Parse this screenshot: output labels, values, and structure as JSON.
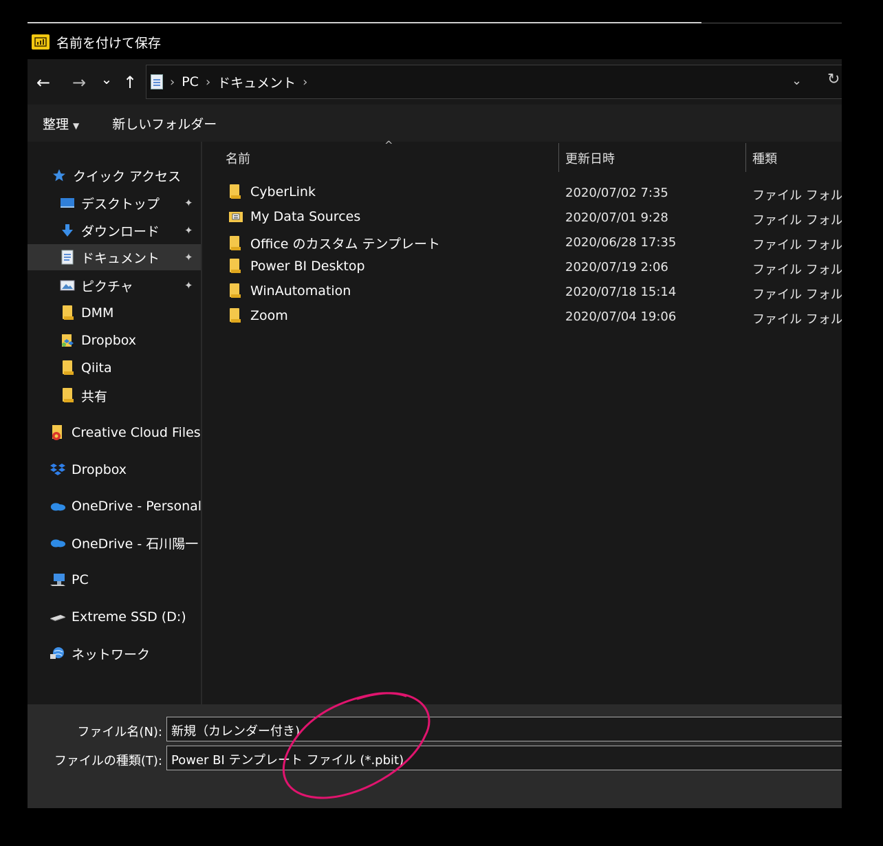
{
  "window": {
    "title": "名前を付けて保存"
  },
  "addressbar": {
    "back_icon": "←",
    "forward_icon": "→",
    "recent_icon": "⌄",
    "up_icon": "↑",
    "separator": "›",
    "crumbs": [
      "PC",
      "ドキュメント"
    ],
    "dropdown_icon": "⌄",
    "refresh_icon": "↻"
  },
  "toolbar": {
    "organize": "整理",
    "new_folder": "新しいフォルダー"
  },
  "navpane": {
    "pin_icon": "📌",
    "items": [
      {
        "label": "クイック アクセス",
        "icon": "star-icon"
      },
      {
        "label": "デスクトップ",
        "icon": "desktop-icon",
        "pinned": true
      },
      {
        "label": "ダウンロード",
        "icon": "download-icon",
        "pinned": true
      },
      {
        "label": "ドキュメント",
        "icon": "document-icon",
        "pinned": true,
        "selected": true
      },
      {
        "label": "ピクチャ",
        "icon": "pictures-icon",
        "pinned": true
      },
      {
        "label": "DMM",
        "icon": "folder-icon"
      },
      {
        "label": "Dropbox",
        "icon": "dropbox-folder-icon"
      },
      {
        "label": "Qiita",
        "icon": "folder-icon"
      },
      {
        "label": "共有",
        "icon": "folder-icon"
      },
      {
        "label": "Creative Cloud Files",
        "icon": "creative-cloud-icon"
      },
      {
        "label": "Dropbox",
        "icon": "dropbox-icon"
      },
      {
        "label": "OneDrive - Personal",
        "icon": "onedrive-icon"
      },
      {
        "label": "OneDrive - 石川陽一",
        "icon": "onedrive-icon"
      },
      {
        "label": "PC",
        "icon": "pc-icon"
      },
      {
        "label": "Extreme SSD (D:)",
        "icon": "drive-icon"
      },
      {
        "label": "ネットワーク",
        "icon": "network-icon"
      }
    ]
  },
  "filelist": {
    "sort_icon": "^",
    "columns": {
      "name": "名前",
      "date": "更新日時",
      "type": "種類"
    },
    "rows": [
      {
        "name": "CyberLink",
        "date": "2020/07/02 7:35",
        "type": "ファイル フォルダー",
        "icon": "folder-icon"
      },
      {
        "name": "My Data Sources",
        "date": "2020/07/01 9:28",
        "type": "ファイル フォルダー",
        "icon": "data-sources-folder-icon"
      },
      {
        "name": "Office のカスタム テンプレート",
        "date": "2020/06/28 17:35",
        "type": "ファイル フォルダー",
        "icon": "folder-icon"
      },
      {
        "name": "Power BI Desktop",
        "date": "2020/07/19 2:06",
        "type": "ファイル フォルダー",
        "icon": "folder-icon"
      },
      {
        "name": "WinAutomation",
        "date": "2020/07/18 15:14",
        "type": "ファイル フォルダー",
        "icon": "folder-icon"
      },
      {
        "name": "Zoom",
        "date": "2020/07/04 19:06",
        "type": "ファイル フォルダー",
        "icon": "folder-icon"
      }
    ]
  },
  "savepanel": {
    "filename_label": "ファイル名(N):",
    "filename_value": "新規（カレンダー付き)",
    "filetype_label": "ファイルの種類(T):",
    "filetype_value": "Power BI テンプレート ファイル (*.pbit)"
  },
  "colors": {
    "annotation": "#e0146e",
    "powerbi": "#f2c811",
    "folder": "#f4c74a",
    "selected": "#333333"
  }
}
